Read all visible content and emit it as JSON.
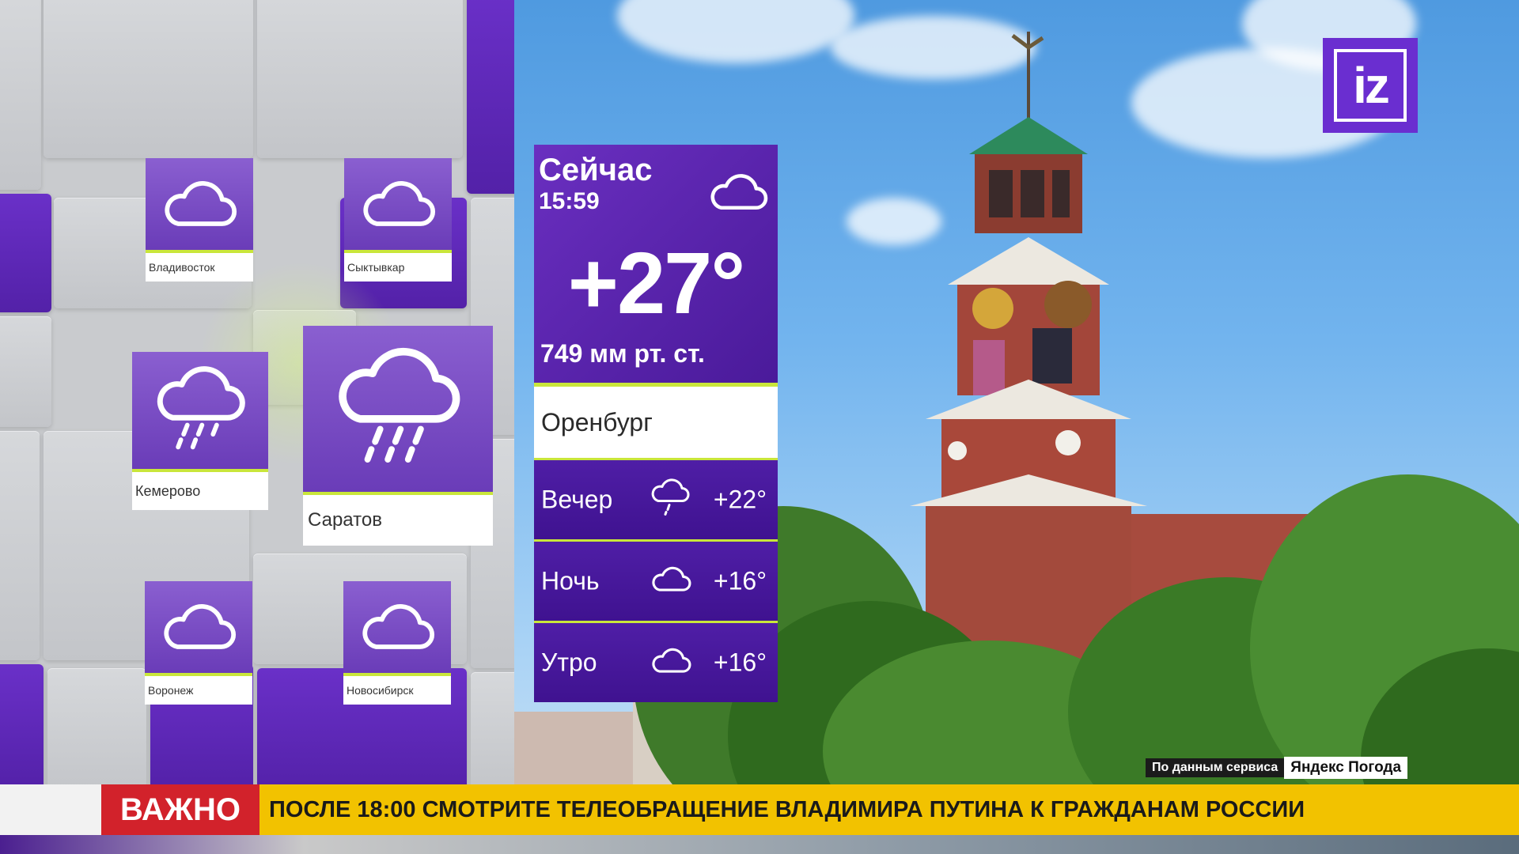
{
  "colors": {
    "brand_purple": "#6a2ed0",
    "accent_green": "#c9e63a",
    "alert_red": "#d2222b",
    "ticker_yellow": "#f2c200"
  },
  "left_map": {
    "cities": [
      {
        "name": "Владивосток",
        "icon": "cloud-icon"
      },
      {
        "name": "Сыктывкар",
        "icon": "cloud-icon"
      },
      {
        "name": "Кемерово",
        "icon": "rain-cloud-icon"
      },
      {
        "name": "Саратов",
        "icon": "rain-cloud-icon"
      },
      {
        "name": "Воронеж",
        "icon": "cloud-icon"
      },
      {
        "name": "Новосибирск",
        "icon": "cloud-icon"
      }
    ]
  },
  "current": {
    "label": "Сейчас",
    "time": "15:59",
    "icon": "cloud-icon",
    "temp": "+27°",
    "pressure": "749 мм рт. ст.",
    "city": "Оренбург"
  },
  "forecast": [
    {
      "label": "Вечер",
      "icon": "rain-cloud-icon",
      "temp": "+22°"
    },
    {
      "label": "Ночь",
      "icon": "cloud-icon",
      "temp": "+16°"
    },
    {
      "label": "Утро",
      "icon": "cloud-icon",
      "temp": "+16°"
    }
  ],
  "logo": {
    "text": "iz"
  },
  "credit": {
    "label": "По данным сервиса",
    "brand": "Яндекс Погода"
  },
  "ticker": {
    "badge": "ВАЖНО",
    "text": "ПОСЛЕ 18:00 СМОТРИТЕ ТЕЛЕОБРАЩЕНИЕ ВЛАДИМИРА ПУТИНА К ГРАЖДАНАМ РОССИИ"
  }
}
